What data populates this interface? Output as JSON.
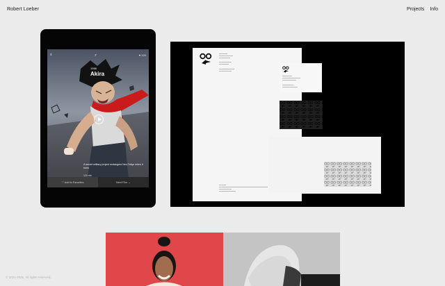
{
  "header": {
    "site_name": "Robert Loeber",
    "nav": [
      "Projects",
      "Info"
    ]
  },
  "tablet_app": {
    "film_year": "1988",
    "film_title": "Akira",
    "favorite_count": "♥ 120",
    "description": "A secret military project endangers Neo-Tokyo when it turns",
    "meta": "124 min",
    "add_to_favorites": "♡ Add to Favorites",
    "next_film": "Next Film →"
  },
  "footer": {
    "copyright": "© 2021-2025. All rights reserved."
  },
  "colors": {
    "background": "#ebebeb",
    "red_backdrop": "#e0474a",
    "scarf_red": "#c91b1b"
  }
}
